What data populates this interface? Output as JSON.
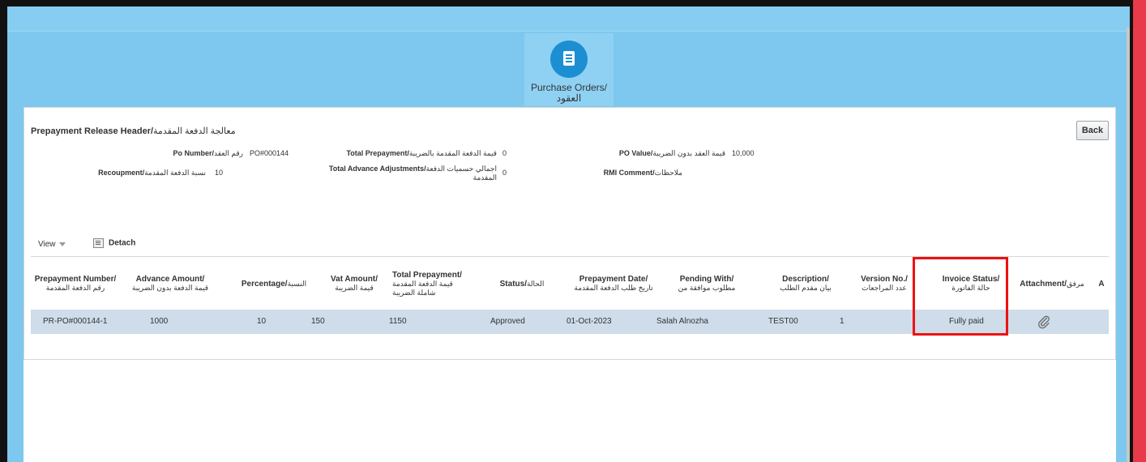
{
  "springboard": {
    "label": "Purchase Orders/العقود",
    "icon": "document-icon"
  },
  "header": {
    "title_en": "Prepayment Release Header/",
    "title_ar": "معالجة الدفعة المقدمة",
    "back_label": "Back"
  },
  "fields": {
    "po_number": {
      "label_en": "Po Number/",
      "label_ar": "رقم العقد",
      "value": "PO#000144"
    },
    "recoupment": {
      "label_en": "Recoupment/",
      "label_ar": "نسبة الدفعة المقدمة",
      "value": "10"
    },
    "total_prepayment": {
      "label_en": "Total Prepayment/",
      "label_ar": "قيمة الدفعة المقدمة بالضريبة",
      "value": "0"
    },
    "total_adjustments": {
      "label_en": "Total Advance Adjustments/",
      "label_ar": "اجمالي حسميات الدفعة المقدمة",
      "value": "0"
    },
    "po_value": {
      "label_en": "PO Value/",
      "label_ar": "قيمة العقد بدون الضريبة",
      "value": "10,000"
    },
    "rmi_comment": {
      "label_en": "RMI Comment/",
      "label_ar": "ملاحظات",
      "value": ""
    }
  },
  "toolbar": {
    "view_label": "View",
    "detach_label": "Detach"
  },
  "table": {
    "columns": [
      {
        "en": "Prepayment Number/",
        "ar": "رقم الدفعة المقدمة"
      },
      {
        "en": "Advance Amount/",
        "ar": "قيمة الدفعة بدون الضريبة"
      },
      {
        "en": "Percentage/",
        "ar": "النسبة"
      },
      {
        "en": "Vat Amount/",
        "ar": "قيمة الضريبة"
      },
      {
        "en": "Total Prepayment/",
        "ar": "قيمة الدفعة المقدمة شاملة الضريبة"
      },
      {
        "en": "Status/",
        "ar": "الحالة"
      },
      {
        "en": "Prepayment Date/",
        "ar": "تاريخ طلب الدفعة المقدمة"
      },
      {
        "en": "Pending With/",
        "ar": "مطلوب موافقة من"
      },
      {
        "en": "Description/",
        "ar": "بيان مقدم الطلب"
      },
      {
        "en": "Version No./",
        "ar": "عدد المراجعات"
      },
      {
        "en": "Invoice Status/",
        "ar": "حالة الفاتورة"
      },
      {
        "en": "Attachment/",
        "ar": "مرفق"
      },
      {
        "en": "A",
        "ar": ""
      }
    ],
    "rows": [
      {
        "prepayment_number": "PR-PO#000144-1",
        "advance_amount": "1000",
        "percentage": "10",
        "vat_amount": "150",
        "total_prepayment": "1150",
        "status": "Approved",
        "prepayment_date": "01-Oct-2023",
        "pending_with": "Salah Alnozha",
        "description": "TEST00",
        "version_no": "1",
        "invoice_status": "Fully paid",
        "attachment_icon": "paperclip-icon"
      }
    ]
  },
  "colors": {
    "highlight": "#ee1111",
    "row_bg": "#cfdcea",
    "app_bg": "#7ec8ef",
    "accent": "#1c8fd2"
  }
}
